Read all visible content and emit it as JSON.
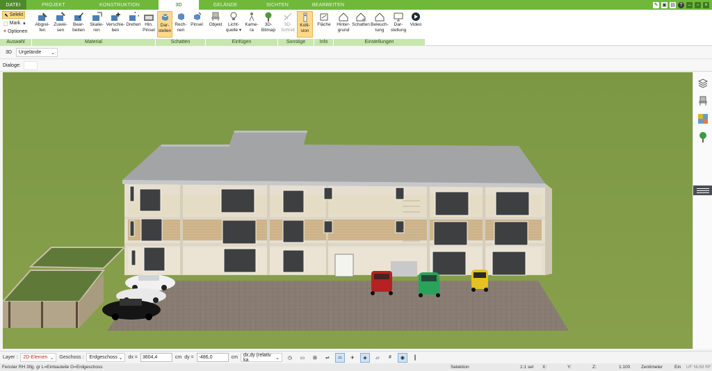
{
  "tabs": {
    "file": "DATEI",
    "projekt": "PROJEKT",
    "konstruktion": "KONSTRUKTION",
    "threed": "3D",
    "gelaende": "GELÄNDE",
    "sichten": "SICHTEN",
    "bearbeiten": "BEARBEITEN"
  },
  "ribbon": {
    "auswahl": {
      "selekt": "Selekt",
      "mark": "Mark.",
      "optionen": "Optionen",
      "label": "Auswahl"
    },
    "material": {
      "label": "Material",
      "b1a": "Abgrei-",
      "b1b": "fen",
      "b2a": "Zuwei-",
      "b2b": "sen",
      "b3a": "Bear-",
      "b3b": "beiten",
      "b4a": "Skalie-",
      "b4b": "ren",
      "b5a": "Verschie-",
      "b5b": "ben",
      "b6a": "Drehen",
      "b6b": "",
      "b7a": "Hin.",
      "b7b": "Pinsel"
    },
    "schatten": {
      "label": "Schatten",
      "b1a": "Dar-",
      "b1b": "stellen",
      "b2a": "Rech-",
      "b2b": "nen",
      "b3a": "Pinsel",
      "b3b": ""
    },
    "einfuegen": {
      "label": "Einfügen",
      "b1a": "Objekt",
      "b1b": "",
      "b2a": "Licht-",
      "b2b": "quelle ▾",
      "b3a": "Kame-",
      "b3b": "ra",
      "b4a": "3D-",
      "b4b": "Bitmap"
    },
    "sonstige": {
      "label": "Sonstige",
      "b1a": "3D-",
      "b1b": "Schnitt",
      "b2a": "Kolli-",
      "b2b": "sion"
    },
    "info": {
      "label": "Info",
      "b1a": "Fläche"
    },
    "einstellungen": {
      "label": "Einstellungen",
      "b1a": "Hinter-",
      "b1b": "grund",
      "b2a": "Schatten",
      "b2b": "",
      "b3a": "Beleuch-",
      "b3b": "tung",
      "b4a": "Dar-",
      "b4b": "stellung",
      "b5a": "Video",
      "b5b": ""
    }
  },
  "viewrow": {
    "mode": "3D",
    "terrain": "Urgelände"
  },
  "dialoge": {
    "label": "Dialoge:"
  },
  "params": {
    "layer_label": "Layer :",
    "layer_value": "2D-Elemen",
    "geschoss_label": "Geschoss :",
    "geschoss_value": "Erdgeschoss",
    "dx_label": "dx =",
    "dx_value": "3604,4",
    "dx_unit": "cm",
    "dy_label": "dy =",
    "dy_value": "-486,0",
    "dy_unit": "cm",
    "rel_value": "dx,dy (relativ ka"
  },
  "status": {
    "info": "Fenster RH 3flg. gr L=Einbauteile G=Erdgeschoss",
    "mode": "Selektion",
    "sel": "1:1 sel",
    "x": "X:",
    "y": "Y:",
    "z": "Z:",
    "scale": "1:100",
    "unit": "Zentimeter",
    "ein": "Ein",
    "flags": "UF NUM RF"
  },
  "colors": {
    "tabbar": "#6fb83a",
    "group_label": "#c8e6b0",
    "active_button": "#fbd98c",
    "grass": "#7f9a46",
    "paving": "#8a7e74"
  }
}
